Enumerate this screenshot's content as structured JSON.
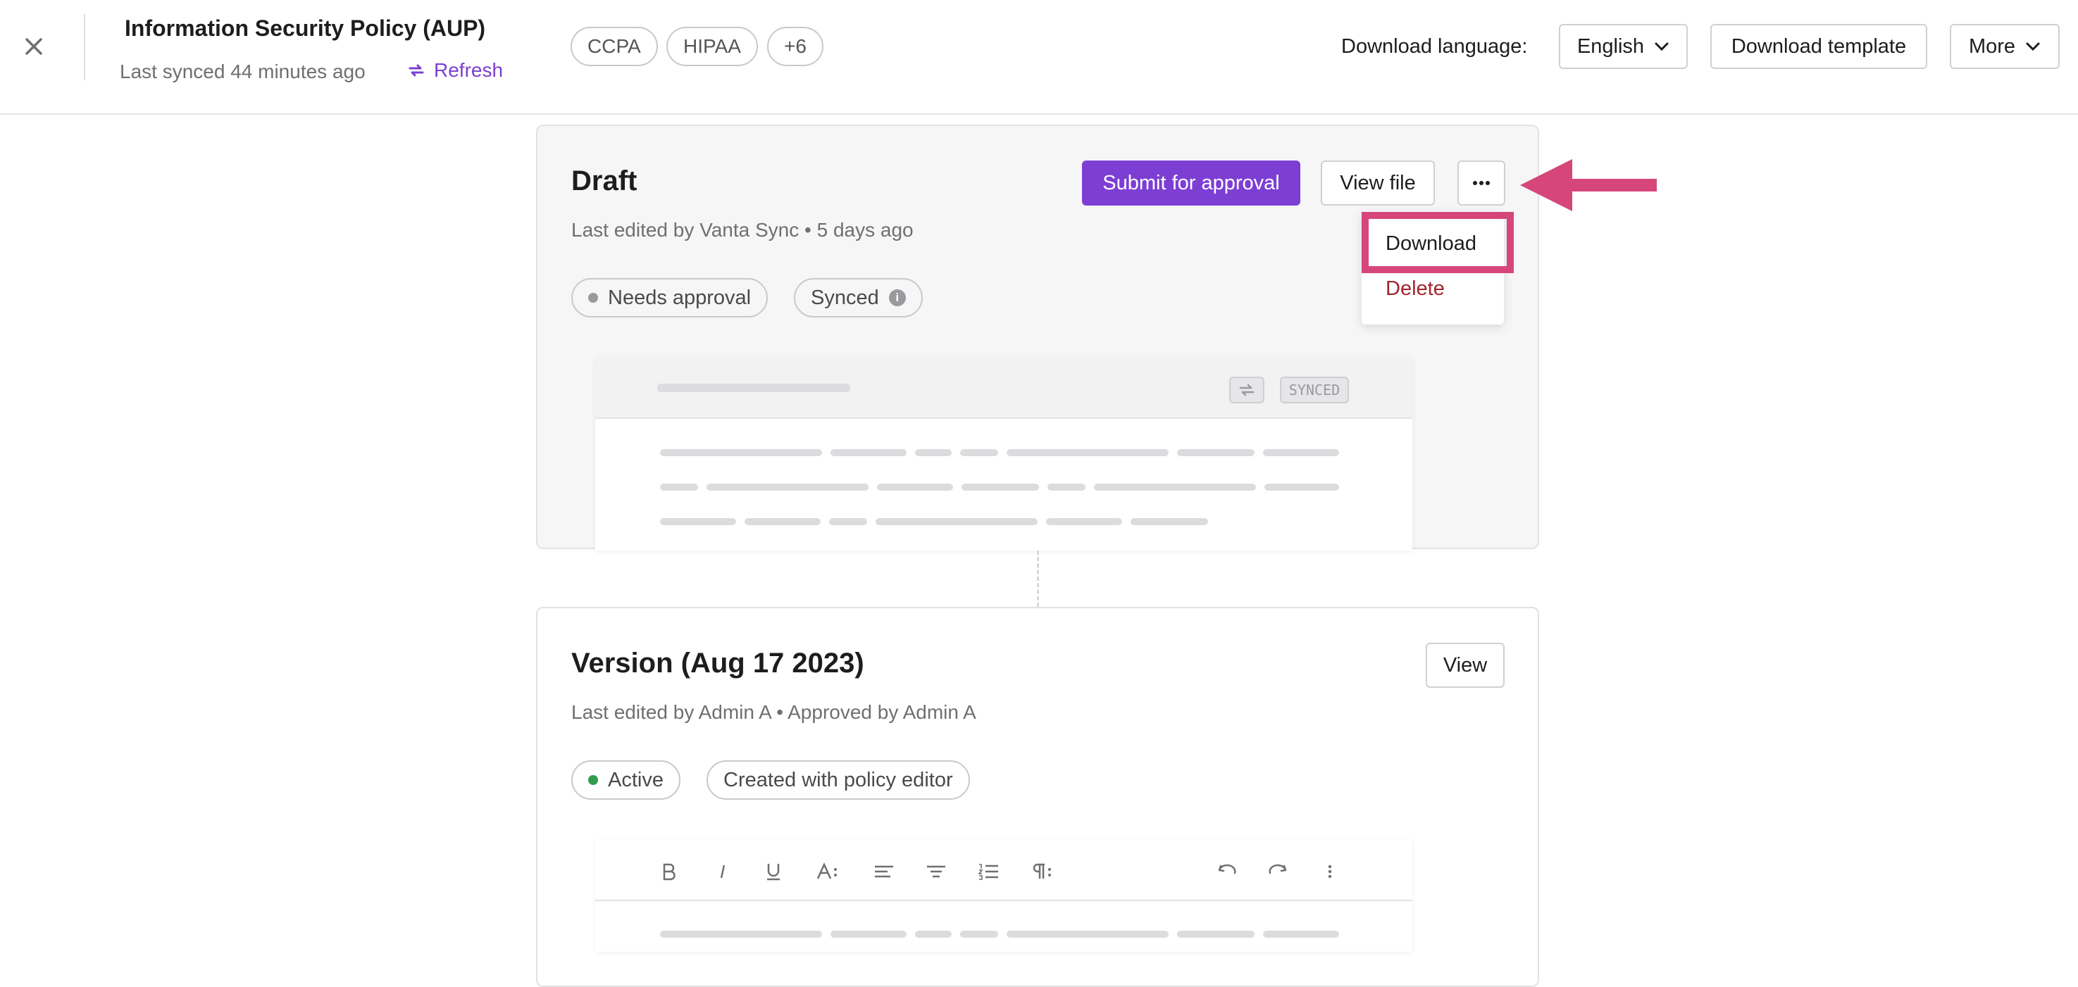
{
  "header": {
    "title": "Information Security Policy (AUP)",
    "synced": "Last synced 44 minutes ago",
    "refresh": "Refresh",
    "chips": [
      "CCPA",
      "HIPAA",
      "+6"
    ],
    "download_language_label": "Download language:",
    "language": "English",
    "download_template": "Download template",
    "more": "More"
  },
  "draft": {
    "title": "Draft",
    "meta": "Last edited by Vanta Sync • 5 days ago",
    "submit": "Submit for approval",
    "view_file": "View file",
    "more_icon": "ellipsis-icon",
    "status_needs_approval": "Needs approval",
    "status_synced": "Synced",
    "preview_badge": "SYNCED",
    "menu": {
      "download": "Download",
      "delete": "Delete"
    }
  },
  "version": {
    "title": "Version (Aug 17 2023)",
    "meta": "Last edited by Admin A • Approved by Admin A",
    "view": "View",
    "status_active": "Active",
    "status_created": "Created with policy editor"
  },
  "colors": {
    "accent": "#7d3ed4",
    "annotation": "#d6467a",
    "delete": "#a3242e",
    "active": "#2f9e4f"
  }
}
